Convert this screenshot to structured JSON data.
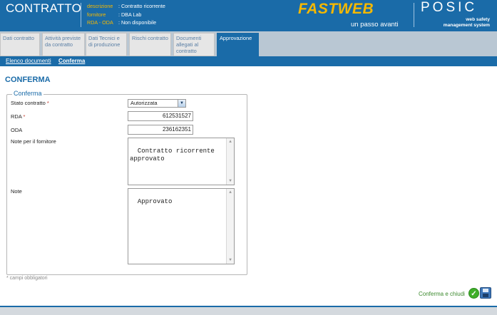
{
  "header": {
    "title": "CONTRATTO",
    "info": [
      {
        "key": "descrizione",
        "value": ": Contratto ricorrente"
      },
      {
        "key": "fornitore",
        "value": ": DBA Lab"
      },
      {
        "key": "RDA - ODA",
        "value": ": Non disponibile"
      }
    ],
    "logo_fastweb": "FASTWEB",
    "slogan": "un passo avanti",
    "logo_posic": "POSIC",
    "posic_sub1": "web safety",
    "posic_sub2": "management system",
    "brand_color": "#1a6ba8",
    "accent_color": "#f5b800"
  },
  "tabs": [
    {
      "label": "Dati contratto"
    },
    {
      "label": "Attività previste da contratto"
    },
    {
      "label": "Dati Tecnici e di produzione"
    },
    {
      "label": "Rischi contratto"
    },
    {
      "label": "Documenti allegati al contratto"
    },
    {
      "label": "Approvazione",
      "active": true
    }
  ],
  "breadcrumb": {
    "link": "Elenco documenti",
    "current": "Conferma"
  },
  "page_title": "CONFERMA",
  "form": {
    "legend": "Conferma",
    "stato_label": "Stato contratto",
    "stato_value": "Autorizzata",
    "rda_label": "RDA",
    "rda_value": "612531527",
    "oda_label": "ODA",
    "oda_value": "236162351",
    "note_fornitore_label": "Note per il fornitore",
    "note_fornitore_value": "Contratto ricorrente approvato",
    "note_label": "Note",
    "note_value": "Approvato",
    "required_marker": "*"
  },
  "footnote": "* campi obbligatori",
  "actions": {
    "confirm_label": "Conferma e chiudi",
    "ok_icon": "check-circle-icon",
    "save_icon": "floppy-disk-icon"
  }
}
